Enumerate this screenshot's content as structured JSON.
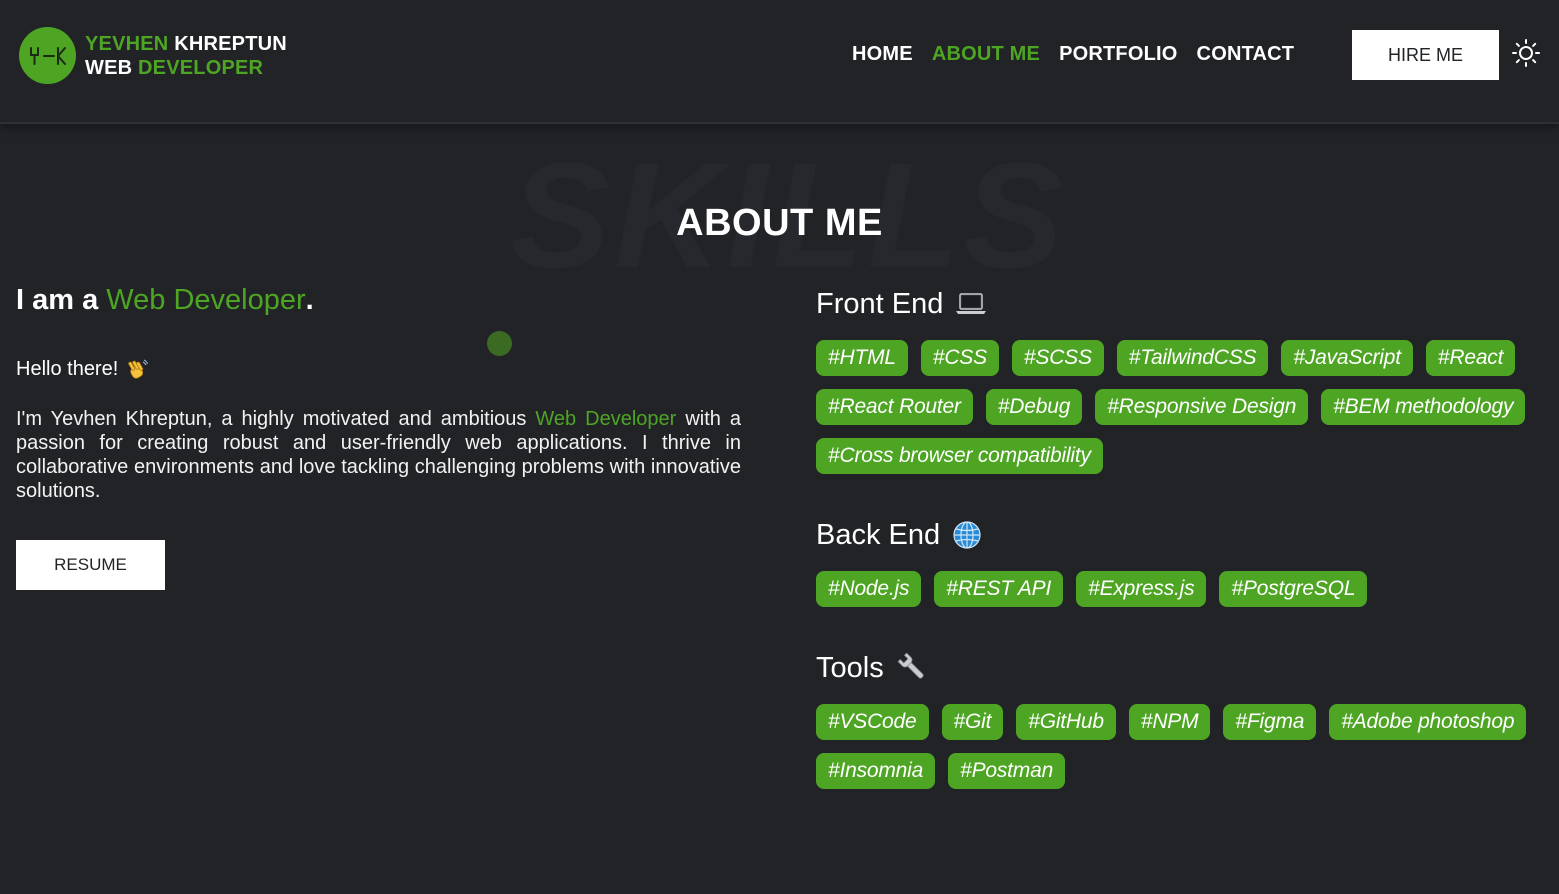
{
  "header": {
    "brand_line1_a": "YEVHEN",
    "brand_line1_b": " KHREPTUN",
    "brand_line2_a": "WEB ",
    "brand_line2_b": "DEVELOPER",
    "logo_text": "YK",
    "nav": [
      "HOME",
      "ABOUT ME",
      "PORTFOLIO",
      "CONTACT"
    ],
    "active_nav": "ABOUT ME",
    "hire_label": "HIRE ME"
  },
  "section": {
    "background_word": "SKILLS",
    "title": "ABOUT ME"
  },
  "about": {
    "intro_prefix": "I am a ",
    "intro_role": "Web Developer",
    "intro_suffix": ".",
    "hello": "Hello there!",
    "bio_prefix": "I'm Yevhen Khreptun, a highly motivated and ambitious ",
    "bio_role": "Web Developer",
    "bio_suffix": " with a passion for creating robust and user-friendly web applications. I thrive in collaborative environments and love tackling challenging problems with innovative solutions.",
    "resume_label": "RESUME"
  },
  "skills": {
    "front_end": {
      "title": "Front End",
      "icon": "laptop-icon",
      "tags": [
        "#HTML",
        "#CSS",
        "#SCSS",
        "#TailwindCSS",
        "#JavaScript",
        "#React",
        "#React Router",
        "#Debug",
        "#Responsive Design",
        "#BEM methodology",
        "#Cross browser compatibility"
      ]
    },
    "back_end": {
      "title": "Back End",
      "icon": "globe-icon",
      "tags": [
        "#Node.js",
        "#REST API",
        "#Express.js",
        "#PostgreSQL"
      ]
    },
    "tools": {
      "title": "Tools",
      "icon": "wrench-icon",
      "tags": [
        "#VSCode",
        "#Git",
        "#GitHub",
        "#NPM",
        "#Figma",
        "#Adobe photoshop",
        "#Insomnia",
        "#Postman"
      ]
    }
  },
  "colors": {
    "background": "#212327",
    "accent": "#4ea524",
    "text": "#ffffff"
  }
}
